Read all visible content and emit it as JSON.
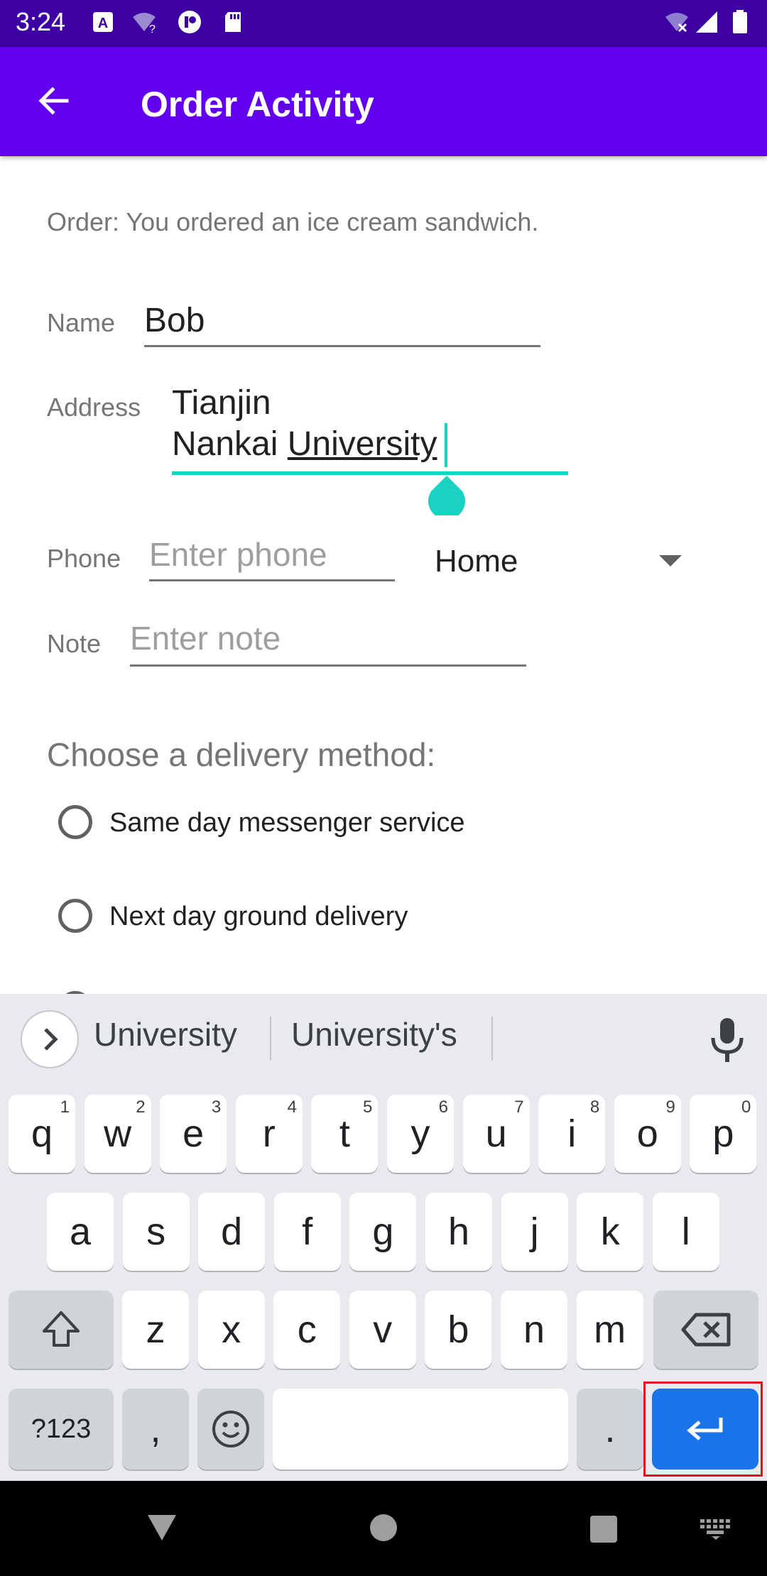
{
  "status_bar": {
    "time": "3:24"
  },
  "app_bar": {
    "title": "Order Activity"
  },
  "order": {
    "text": "Order: You ordered an ice cream sandwich."
  },
  "form": {
    "name_label": "Name",
    "name_value": "Bob",
    "address_label": "Address",
    "address_line1": "Tianjin",
    "address_line2_prefix": "Nankai ",
    "address_line2_word": "University",
    "phone_label": "Phone",
    "phone_placeholder": "Enter phone",
    "phone_type": "Home",
    "note_label": "Note",
    "note_placeholder": "Enter note"
  },
  "delivery": {
    "heading": "Choose a delivery method:",
    "options": [
      "Same day messenger service",
      "Next day ground delivery"
    ]
  },
  "keyboard": {
    "suggestions": [
      "University",
      "University's"
    ],
    "row1": [
      {
        "k": "q",
        "n": "1"
      },
      {
        "k": "w",
        "n": "2"
      },
      {
        "k": "e",
        "n": "3"
      },
      {
        "k": "r",
        "n": "4"
      },
      {
        "k": "t",
        "n": "5"
      },
      {
        "k": "y",
        "n": "6"
      },
      {
        "k": "u",
        "n": "7"
      },
      {
        "k": "i",
        "n": "8"
      },
      {
        "k": "o",
        "n": "9"
      },
      {
        "k": "p",
        "n": "0"
      }
    ],
    "row2": [
      "a",
      "s",
      "d",
      "f",
      "g",
      "h",
      "j",
      "k",
      "l"
    ],
    "row3": [
      "z",
      "x",
      "c",
      "v",
      "b",
      "n",
      "m"
    ],
    "symbols_key": "?123",
    "comma_key": ",",
    "period_key": "."
  },
  "colors": {
    "status_bar": "#3c00a3",
    "app_bar": "#6200ee",
    "accent": "#1ad1c2",
    "enter_key": "#1a73e8"
  }
}
